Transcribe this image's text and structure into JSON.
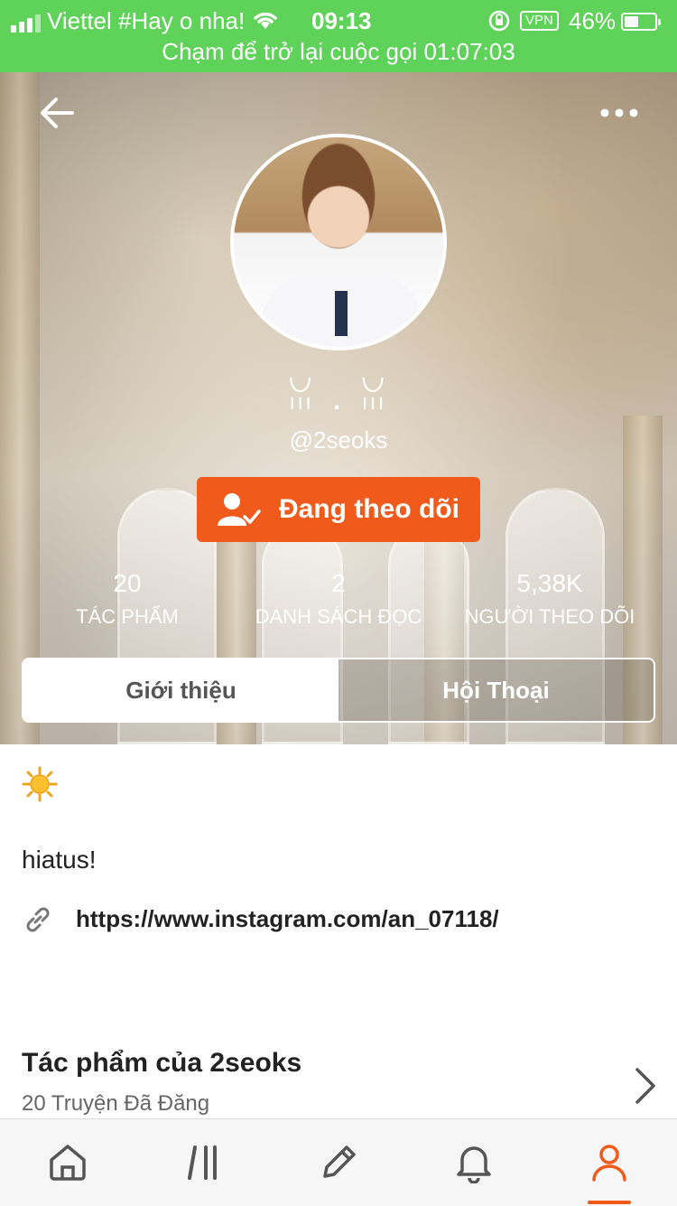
{
  "status_bar": {
    "carrier": "Viettel #Hay o nha!",
    "time": "09:13",
    "vpn": "VPN",
    "battery_pct": "46%",
    "battery_level": 0.46,
    "call_banner": "Chạm để trở lại cuộc gọi 01:07:03"
  },
  "header": {
    "icons": [
      "back-arrow-icon",
      "more-dots-icon"
    ]
  },
  "profile": {
    "display_name": "ꈍ . ꈍ",
    "handle": "@2seoks",
    "follow_label": "Đang theo dõi"
  },
  "stats": [
    {
      "value": "20",
      "label": "TÁC PHẨM"
    },
    {
      "value": "2",
      "label": "DANH SÁCH ĐỌC"
    },
    {
      "value": "5,38K",
      "label": "NGƯỜI THEO DÕI"
    }
  ],
  "tabs": [
    {
      "label": "Giới thiệu",
      "active": true
    },
    {
      "label": "Hội Thoại",
      "active": false
    }
  ],
  "about": {
    "bio": "hiatus!",
    "link": "https://www.instagram.com/an_07118/"
  },
  "works": {
    "title": "Tác phẩm của 2seoks",
    "subtitle": "20 Truyện Đã Đăng"
  },
  "bottom_nav": [
    {
      "icon": "home-icon",
      "active": false
    },
    {
      "icon": "browse-icon",
      "active": false
    },
    {
      "icon": "pencil-icon",
      "active": false
    },
    {
      "icon": "bell-icon",
      "active": false
    },
    {
      "icon": "profile-icon",
      "active": true
    }
  ],
  "colors": {
    "status_green": "#5fd25a",
    "accent_orange": "#f05a1a"
  }
}
